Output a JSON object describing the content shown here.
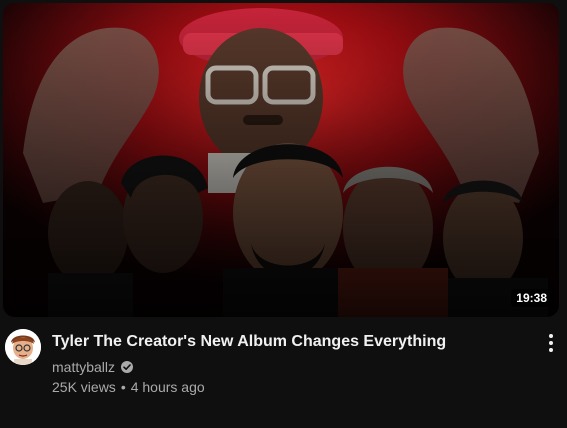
{
  "video": {
    "title": "Tyler The Creator's New Album Changes Everything",
    "duration": "19:38",
    "channel": "mattyballz",
    "views": "25K views",
    "separator": "•",
    "age": "4 hours ago"
  },
  "icons": {
    "verified": "verified-check-icon",
    "menu": "more-vert-icon"
  },
  "colors": {
    "background": "#0f0f0f",
    "title": "#f1f1f1",
    "secondary_text": "#aaaaaa",
    "thumbnail_glow": "#d8141c"
  }
}
